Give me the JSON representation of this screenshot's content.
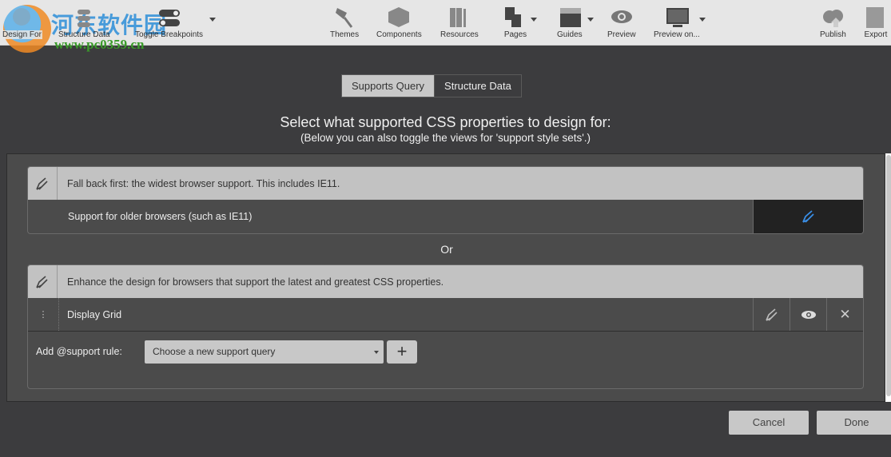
{
  "toolbar": {
    "items": [
      {
        "label": "Design For",
        "icon": "design-for-icon"
      },
      {
        "label": "Structure Data",
        "icon": "database-icon"
      },
      {
        "label": "Toggle Breakpoints",
        "icon": "toggle-icon"
      },
      {
        "label": "Themes",
        "icon": "paintbrush-icon"
      },
      {
        "label": "Components",
        "icon": "cube-icon"
      },
      {
        "label": "Resources",
        "icon": "books-icon"
      },
      {
        "label": "Pages",
        "icon": "pages-icon"
      },
      {
        "label": "Guides",
        "icon": "guides-icon"
      },
      {
        "label": "Preview",
        "icon": "eye-icon"
      },
      {
        "label": "Preview on...",
        "icon": "monitor-icon"
      },
      {
        "label": "Publish",
        "icon": "cloud-upload-icon"
      },
      {
        "label": "Export",
        "icon": "export-icon"
      }
    ]
  },
  "watermark": {
    "name": "河东软件园",
    "url": "www.pc0359.cn"
  },
  "tabs": [
    {
      "label": "Supports Query",
      "active": true
    },
    {
      "label": "Structure Data",
      "active": false
    }
  ],
  "heading": "Select what supported CSS properties to design for:",
  "subheading": "(Below you can also toggle the views for 'support style sets'.)",
  "fallback": {
    "header": "Fall back first: the widest browser support. This includes IE11.",
    "row": "Support for older browsers (such as IE11)"
  },
  "or_label": "Or",
  "enhance": {
    "header": "Enhance the design for browsers that support the latest and greatest CSS properties.",
    "rows": [
      {
        "label": "Display Grid"
      }
    ],
    "add_label": "Add @support rule:",
    "select_value": "Choose a new support query",
    "add_button": "+"
  },
  "footer": {
    "cancel": "Cancel",
    "done": "Done"
  },
  "colors": {
    "accent": "#3a8ee6"
  }
}
